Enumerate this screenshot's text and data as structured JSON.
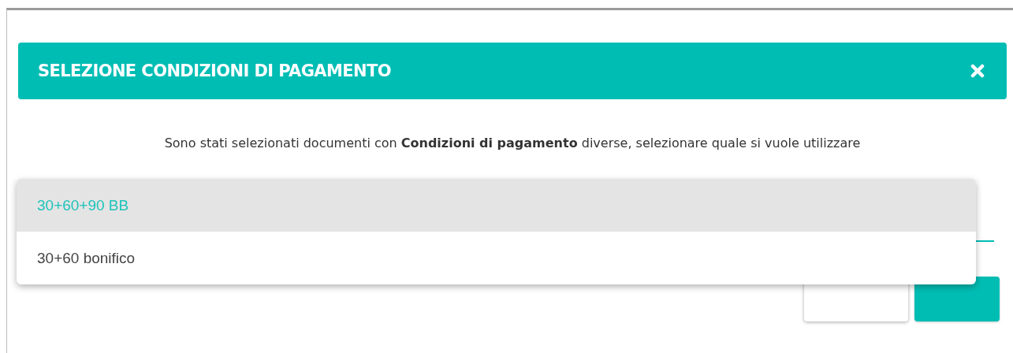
{
  "dialog": {
    "title": "SELEZIONE CONDIZIONI DI PAGAMENTO",
    "message": "Sono stati selezionati documenti con **Condizioni di pagamento** diverse, selezionare quale si vuole utilizzare"
  },
  "options": [
    {
      "label": "30+60+90 BB",
      "selected": true
    },
    {
      "label": "30+60 bonifico",
      "selected": false
    }
  ],
  "buttons": [
    {
      "kind": "secondary"
    },
    {
      "kind": "primary"
    }
  ]
}
